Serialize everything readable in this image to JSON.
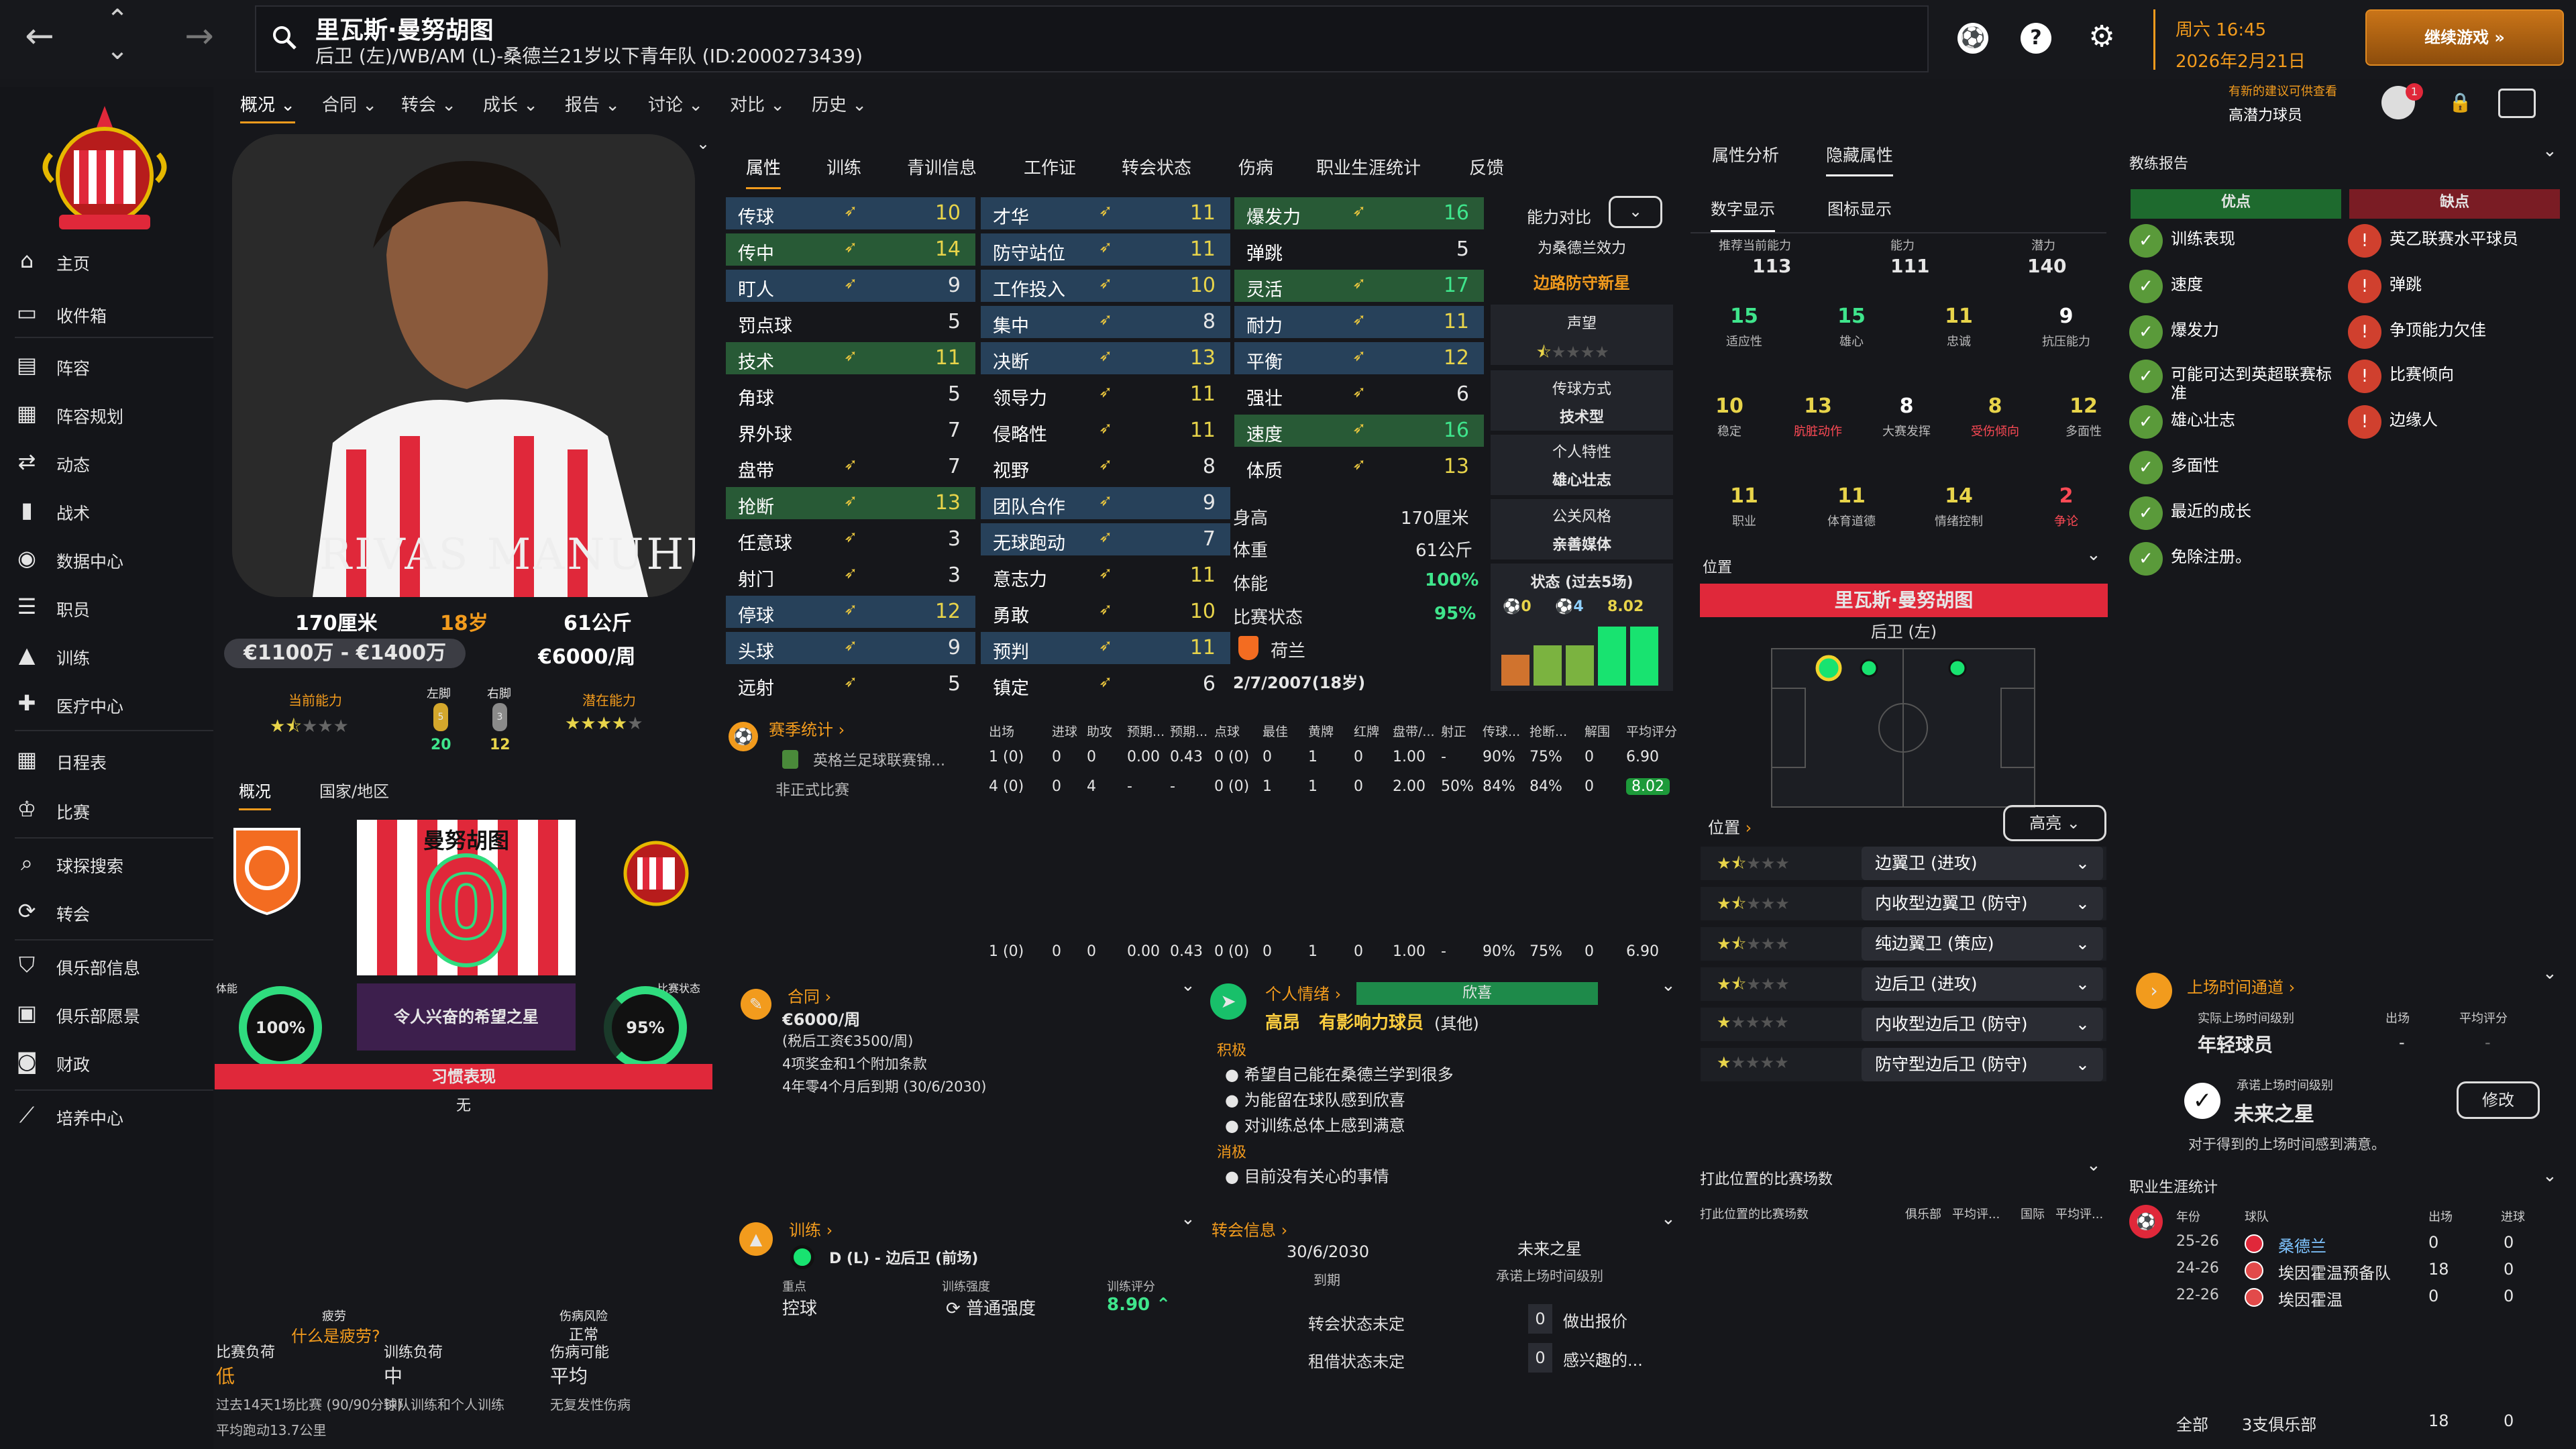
{
  "nav": {
    "back": "←",
    "up": "⌃",
    "down": "⌄",
    "forward": "→"
  },
  "player": {
    "name": "里瓦斯·曼努胡图",
    "subtitle": "后卫 (左)/WB/AM (L)-桑德兰21岁以下青年队 (ID:2000273439)",
    "height": "170厘米",
    "age": "18岁",
    "weight": "61公斤",
    "value": "€1100万 - €1400万",
    "wage": "€6000/周",
    "photo_text": "RIVAS MANUHUTU",
    "current_ability_label": "当前能力",
    "potential_ability_label": "潜在能力",
    "current_ability_stars": 1.5,
    "potential_ability_stars": 4,
    "left_foot_label": "左脚",
    "right_foot_label": "右脚",
    "left_foot_val": "20",
    "right_foot_val": "12",
    "left_foot_rating": "5",
    "right_foot_rating": "3"
  },
  "topbar": {
    "date_day": "周六 16:45",
    "date": "2026年2月21日",
    "continue": "继续游戏",
    "suggest": "有新的建议可供查看",
    "suggest_sub": "高潜力球员",
    "suggest_count": "1",
    "icons": [
      "ball-icon",
      "help-icon",
      "settings-icon"
    ]
  },
  "menu": [
    "概况",
    "合同",
    "转会",
    "成长",
    "报告",
    "讨论",
    "对比",
    "历史"
  ],
  "sidebar": [
    {
      "label": "主页",
      "icon": "home-icon"
    },
    {
      "label": "收件箱",
      "icon": "inbox-icon"
    },
    {
      "label": "阵容",
      "icon": "squad-icon"
    },
    {
      "label": "阵容规划",
      "icon": "planner-icon"
    },
    {
      "label": "动态",
      "icon": "dynamics-icon"
    },
    {
      "label": "战术",
      "icon": "tactics-icon"
    },
    {
      "label": "数据中心",
      "icon": "data-icon"
    },
    {
      "label": "职员",
      "icon": "staff-icon"
    },
    {
      "label": "训练",
      "icon": "training-icon"
    },
    {
      "label": "医疗中心",
      "icon": "medical-icon"
    },
    {
      "label": "日程表",
      "icon": "calendar-icon"
    },
    {
      "label": "比赛",
      "icon": "trophy-icon"
    },
    {
      "label": "球探搜索",
      "icon": "scout-icon"
    },
    {
      "label": "转会",
      "icon": "transfer-icon"
    },
    {
      "label": "俱乐部信息",
      "icon": "club-icon"
    },
    {
      "label": "俱乐部愿景",
      "icon": "vision-icon"
    },
    {
      "label": "财政",
      "icon": "finance-icon"
    },
    {
      "label": "培养中心",
      "icon": "development-icon"
    }
  ],
  "left_tabs": [
    "概况",
    "国家/地区"
  ],
  "shirt": {
    "name": "曼努胡图",
    "number": "0"
  },
  "condition": {
    "fitness_label": "体能",
    "fitness": "100%",
    "form_label": "比赛状态",
    "form": "95%",
    "trait": "令人兴奋的希望之星",
    "habit_label": "习惯表现",
    "habit": "无"
  },
  "fatigue": {
    "title": "疲劳",
    "question": "什么是疲劳?",
    "injury_title": "伤病风险",
    "injury_status": "正常",
    "match_load_label": "比赛负荷",
    "match_load": "低",
    "train_load_label": "训练负荷",
    "train_load": "中",
    "injury_chance_label": "伤病可能",
    "injury_chance": "平均",
    "desc1": "过去14天1场比赛 (90/90分钟)",
    "desc2": "平均跑动13.7公里",
    "desc3": "球队训练和个人训练",
    "desc4": "无复发性伤病"
  },
  "attr_tabs": [
    "属性",
    "训练",
    "青训信息",
    "工作证",
    "转会状态",
    "伤病",
    "职业生涯统计",
    "反馈"
  ],
  "technical": [
    [
      "传球",
      "10"
    ],
    [
      "传中",
      "14"
    ],
    [
      "盯人",
      "9"
    ],
    [
      "罚点球",
      "5"
    ],
    [
      "技术",
      "11"
    ],
    [
      "角球",
      "5"
    ],
    [
      "界外球",
      "7"
    ],
    [
      "盘带",
      "7"
    ],
    [
      "抢断",
      "13"
    ],
    [
      "任意球",
      "3"
    ],
    [
      "射门",
      "3"
    ],
    [
      "停球",
      "12"
    ],
    [
      "头球",
      "9"
    ],
    [
      "远射",
      "5"
    ]
  ],
  "mental": [
    [
      "才华",
      "11"
    ],
    [
      "防守站位",
      "11"
    ],
    [
      "工作投入",
      "10"
    ],
    [
      "集中",
      "8"
    ],
    [
      "决断",
      "13"
    ],
    [
      "领导力",
      "11"
    ],
    [
      "侵略性",
      "11"
    ],
    [
      "视野",
      "8"
    ],
    [
      "团队合作",
      "9"
    ],
    [
      "无球跑动",
      "7"
    ],
    [
      "意志力",
      "11"
    ],
    [
      "勇敢",
      "10"
    ],
    [
      "预判",
      "11"
    ],
    [
      "镇定",
      "6"
    ]
  ],
  "physical": [
    [
      "爆发力",
      "16"
    ],
    [
      "弹跳",
      "5"
    ],
    [
      "灵活",
      "17"
    ],
    [
      "耐力",
      "11"
    ],
    [
      "平衡",
      "12"
    ],
    [
      "强壮",
      "6"
    ],
    [
      "速度",
      "16"
    ],
    [
      "体质",
      "13"
    ]
  ],
  "body": {
    "height_label": "身高",
    "height": "170厘米",
    "weight_label": "体重",
    "weight": "61公斤",
    "fitness_label": "体能",
    "fitness": "100%",
    "form_label": "比赛状态",
    "form": "95%",
    "nation": "荷兰",
    "dob": "2/7/2007(18岁)"
  },
  "compare": {
    "label": "能力对比",
    "club": "为桑德兰效力",
    "role": "边路防守新星",
    "rep_label": "声望",
    "style_label": "传球方式",
    "style": "技术型",
    "pers_label": "个人特性",
    "pers": "雄心壮志",
    "media_label": "公关风格",
    "media": "亲善媒体",
    "form_label": "状态 (过去5场)",
    "stat1": "0",
    "stat2": "4",
    "stat3": "8.02"
  },
  "season": {
    "title": "赛季统计",
    "headers": [
      "出场",
      "进球",
      "助攻",
      "预期...",
      "预期...",
      "点球",
      "最佳",
      "黄牌",
      "红牌",
      "盘带/...",
      "射正",
      "传球...",
      "抢断...",
      "解围",
      "平均评分"
    ],
    "rows": [
      {
        "comp": "英格兰足球联赛锦...",
        "vals": [
          "1 (0)",
          "0",
          "0",
          "0.00",
          "0.43",
          "0 (0)",
          "0",
          "1",
          "0",
          "1.00",
          "-",
          "90%",
          "75%",
          "0",
          "6.90"
        ]
      },
      {
        "comp": "非正式比赛",
        "vals": [
          "4 (0)",
          "0",
          "4",
          "-",
          "-",
          "0 (0)",
          "1",
          "1",
          "0",
          "2.00",
          "50%",
          "84%",
          "84%",
          "0",
          "8.02"
        ]
      }
    ],
    "total": [
      "1 (0)",
      "0",
      "0",
      "0.00",
      "0.43",
      "0 (0)",
      "0",
      "1",
      "0",
      "1.00",
      "-",
      "90%",
      "75%",
      "0",
      "6.90"
    ]
  },
  "contract": {
    "title": "合同",
    "wage": "€6000/周",
    "tax": "(税后工资€3500/周)",
    "clauses": "4项奖金和1个附加条款",
    "expires": "4年零4个月后到期 (30/6/2030)"
  },
  "mood": {
    "title": "个人情绪",
    "status": "欣喜",
    "level": "高昂",
    "influence": "有影响力球员",
    "influence_sub": "(其他)",
    "pos_label": "积极",
    "pos": [
      "希望自己能在桑德兰学到很多",
      "为能留在球队感到欣喜",
      "对训练总体上感到满意"
    ],
    "neg_label": "消极",
    "neg": [
      "目前没有关心的事情"
    ]
  },
  "training": {
    "title": "训练",
    "role": "D (L) - 边后卫 (前场)",
    "focus_label": "重点",
    "focus": "控球",
    "intensity_label": "训练强度",
    "intensity": "普通强度",
    "rating_label": "训练评分",
    "rating": "8.90"
  },
  "transfer": {
    "title": "转会信息",
    "expiry": "30/6/2030",
    "expiry_label": "到期",
    "future": "未来之星",
    "future_label": "承诺上场时间级别",
    "status1": "转会状态未定",
    "status2": "租借状态未定",
    "offer_count": "0",
    "offer": "做出报价",
    "interest_count": "0",
    "interest": "感兴趣的..."
  },
  "hidden": {
    "tab1": "属性分析",
    "tab2": "隐藏属性",
    "sub1": "数字显示",
    "sub2": "图标显示",
    "rec_label": "推荐当前能力",
    "rec": "113",
    "ability_label": "能力",
    "ability": "111",
    "pot_label": "潜力",
    "pot": "140",
    "grid": [
      [
        "15",
        "适应性"
      ],
      [
        "15",
        "雄心"
      ],
      [
        "11",
        "忠诚"
      ],
      [
        "9",
        "抗压能力"
      ],
      [
        "10",
        "稳定"
      ],
      [
        "13",
        "肮脏动作"
      ],
      [
        "8",
        "大赛发挥"
      ],
      [
        "8",
        "受伤倾向"
      ],
      [
        "12",
        "多面性"
      ],
      [
        "11",
        "职业"
      ],
      [
        "11",
        "体育道德"
      ],
      [
        "14",
        "情绪控制"
      ],
      [
        "2",
        "争论"
      ]
    ]
  },
  "positions": {
    "title": "位置",
    "name": "里瓦斯·曼努胡图",
    "pos": "后卫 (左)",
    "list_title": "位置",
    "highlight": "高亮",
    "roles": [
      {
        "name": "边翼卫 (进攻)",
        "stars": 1.5
      },
      {
        "name": "内收型边翼卫 (防守)",
        "stars": 1.5
      },
      {
        "name": "纯边翼卫 (策应)",
        "stars": 1.5
      },
      {
        "name": "边后卫 (进攻)",
        "stars": 1.5
      },
      {
        "name": "内收型边后卫 (防守)",
        "stars": 1
      },
      {
        "name": "防守型边后卫 (防守)",
        "stars": 1
      }
    ],
    "apps_title": "打此位置的比赛场数",
    "apps_sub": "打此位置的比赛场数",
    "apps_cols": [
      "俱乐部",
      "平均评...",
      "国际",
      "平均评..."
    ]
  },
  "report": {
    "title": "教练报告",
    "pros_title": "优点",
    "cons_title": "缺点",
    "pros": [
      "训练表现",
      "速度",
      "爆发力",
      "可能可达到英超联赛标准",
      "雄心壮志",
      "多面性",
      "最近的成长",
      "免除注册。"
    ],
    "cons": [
      "英乙联赛水平球员",
      "弹跳",
      "争顶能力欠佳",
      "比赛倾向",
      "边缘人"
    ]
  },
  "playtime": {
    "title": "上场时间通道",
    "actual_label": "实际上场时间级别",
    "actual": "年轻球员",
    "apps_label": "出场",
    "apps": "-",
    "avg_label": "平均评分",
    "avg": "-",
    "promised_label": "承诺上场时间级别",
    "promised": "未来之星",
    "edit": "修改",
    "satisfied": "对于得到的上场时间感到满意。"
  },
  "career": {
    "title": "职业生涯统计",
    "cols": [
      "年份",
      "球队",
      "出场",
      "进球"
    ],
    "rows": [
      [
        "25-26",
        "桑德兰",
        "0",
        "0"
      ],
      [
        "24-26",
        "埃因霍温预备队",
        "18",
        "0"
      ],
      [
        "22-26",
        "埃因霍温",
        "0",
        "0"
      ]
    ],
    "total_label": "全部",
    "total_clubs": "3支俱乐部",
    "total_apps": "18",
    "total_goals": "0"
  },
  "colors": {
    "accent": "#f29b1d",
    "green": "#3fe58c",
    "red": "#e0283a",
    "blue_hl": "#27415a",
    "green_hl": "#285a36"
  }
}
